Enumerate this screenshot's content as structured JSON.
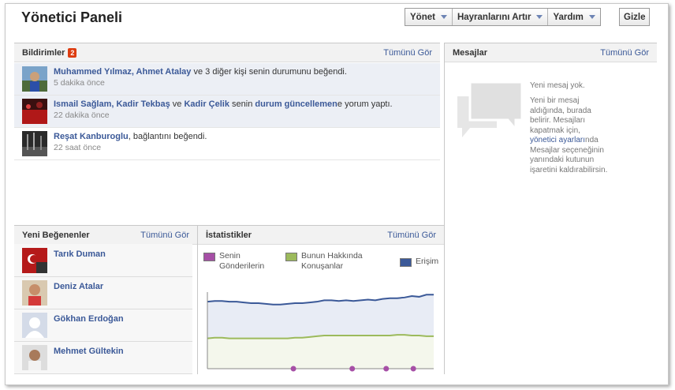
{
  "header": {
    "title": "Yönetici Paneli",
    "menu": [
      "Yönet",
      "Hayranlarını Artır",
      "Yardım"
    ],
    "hide_label": "Gizle"
  },
  "notifications": {
    "title": "Bildirimler",
    "count": "2",
    "see_all": "Tümünü Gör",
    "items": [
      {
        "actors": "Muhammed Yılmaz, Ahmet Atalay",
        "text": " ve 3 diğer kişi senin durumunu beğendi.",
        "time": "5 dakika önce"
      },
      {
        "actor1": "Ismail Sağlam, Kadir Tekbaş",
        "mid1": " ve ",
        "actor2": "Kadir Çelik",
        "mid2": " senin ",
        "object": "durum güncellemen",
        "text": "e yorum yaptı.",
        "time": "22 dakika önce"
      },
      {
        "actors": "Reşat Kanburoglu",
        "text": ", bağlantını beğendi.",
        "time": "22 saat önce"
      }
    ]
  },
  "messages": {
    "title": "Mesajlar",
    "see_all": "Tümünü Gör",
    "empty": "Yeni mesaj yok.",
    "info_pre": "Yeni bir mesaj aldığında, burada belirir. Mesajları kapatmak için, ",
    "info_link": "yönetici ayarları",
    "info_post": "nda Mesajlar seçeneğinin yanındaki kutunun işaretini kaldırabilirsin."
  },
  "new_fans": {
    "title": "Yeni Beğenenler",
    "see_all": "Tümünü Gör",
    "items": [
      "Tarık Duman",
      "Deniz Atalar",
      "Gökhan Erdoğan",
      "Mehmet Gültekin"
    ]
  },
  "stats": {
    "title": "İstatistikler",
    "see_all": "Tümünü Gör",
    "colors": {
      "posts": "#a64fa6",
      "talking": "#9cba5c",
      "reach": "#3b5998",
      "reach_fill": "#e8ecf5",
      "talking_fill": "#f4f7ec"
    },
    "chart_data": {
      "type": "line",
      "series": [
        {
          "name": "Senin Gönderilerin",
          "values": [
            0,
            0,
            0,
            0,
            0,
            0,
            0,
            0,
            0,
            0,
            0,
            0,
            0,
            0,
            0,
            0,
            0,
            0,
            0,
            0,
            0,
            0,
            0,
            0,
            0,
            0,
            0,
            0,
            0,
            0,
            0,
            0,
            0,
            0,
            0,
            0,
            0,
            0,
            0,
            0,
            0,
            0,
            0,
            0,
            0,
            0,
            0,
            0,
            0,
            0,
            0,
            0,
            0,
            0,
            0,
            0,
            0,
            0,
            0,
            0,
            0,
            0,
            0,
            0,
            0,
            0,
            0,
            0,
            0,
            0,
            0,
            0,
            0,
            0,
            0,
            0,
            0,
            0,
            0,
            0,
            0,
            0,
            0,
            0,
            0,
            0,
            0,
            0,
            0,
            0,
            0,
            0,
            0,
            0,
            0,
            0,
            0,
            0,
            0,
            0
          ]
        },
        {
          "name": "Bunun Hakkında Konuşanlar",
          "values": [
            43,
            44,
            44,
            43,
            43,
            43,
            43,
            43,
            43,
            43,
            43,
            43,
            44,
            44,
            45,
            46,
            47,
            47,
            47,
            47,
            47,
            47,
            47,
            47,
            47,
            47,
            48,
            48,
            47,
            47,
            46,
            46
          ]
        },
        {
          "name": "Erişim",
          "values": [
            95,
            96,
            96,
            95,
            95,
            94,
            93,
            93,
            92,
            91,
            91,
            92,
            93,
            93,
            94,
            95,
            97,
            97,
            96,
            97,
            96,
            97,
            98,
            97,
            99,
            100,
            100,
            101,
            103,
            102,
            105,
            105
          ]
        }
      ],
      "post_markers": [
        0.38,
        0.64,
        0.79,
        0.91
      ],
      "ylim": [
        0,
        140
      ]
    }
  }
}
